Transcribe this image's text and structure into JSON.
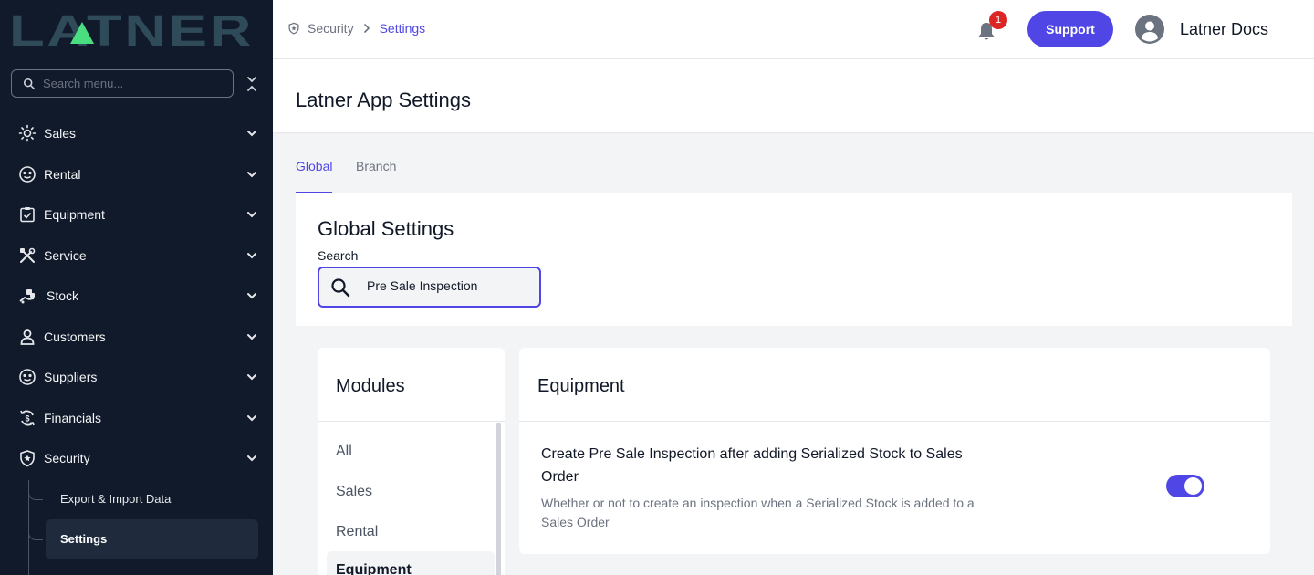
{
  "app": {
    "brand": "LATNER",
    "colors": {
      "sidebar_bg": "#111a2b",
      "accent": "#4f46e5",
      "badge": "#dc2626",
      "logo": "#2f4a58",
      "logo_mark": "#4ade80"
    }
  },
  "sidebar": {
    "search_placeholder": "Search menu...",
    "items": [
      {
        "label": "Sales",
        "icon": "sales-icon"
      },
      {
        "label": "Rental",
        "icon": "rental-icon"
      },
      {
        "label": "Equipment",
        "icon": "equipment-icon"
      },
      {
        "label": "Service",
        "icon": "service-icon"
      },
      {
        "label": "Stock",
        "icon": "stock-icon"
      },
      {
        "label": "Customers",
        "icon": "customers-icon"
      },
      {
        "label": "Suppliers",
        "icon": "suppliers-icon"
      },
      {
        "label": "Financials",
        "icon": "financials-icon"
      },
      {
        "label": "Security",
        "icon": "security-icon"
      }
    ],
    "security_sub_items": [
      {
        "label": "Export & Import Data",
        "active": false
      },
      {
        "label": "Settings",
        "active": true
      }
    ]
  },
  "topbar": {
    "breadcrumb": {
      "first": "Security",
      "current": "Settings"
    },
    "notifications_count": "1",
    "support_label": "Support",
    "user_name": "Latner Docs"
  },
  "page": {
    "title": "Latner App Settings",
    "tabs": [
      {
        "label": "Global",
        "active": true
      },
      {
        "label": "Branch",
        "active": false
      }
    ]
  },
  "global_settings": {
    "title": "Global Settings",
    "search_label": "Search",
    "search_value": "Pre Sale Inspection"
  },
  "modules": {
    "title": "Modules",
    "items": [
      {
        "label": "All",
        "active": false
      },
      {
        "label": "Sales",
        "active": false
      },
      {
        "label": "Rental",
        "active": false
      },
      {
        "label": "Equipment",
        "active": true
      }
    ]
  },
  "equipment": {
    "title": "Equipment",
    "setting": {
      "title": "Create Pre Sale Inspection after adding Serialized Stock to Sales Order",
      "description": "Whether or not to create an inspection when a Serialized Stock is added to a Sales Order",
      "enabled": true
    }
  }
}
